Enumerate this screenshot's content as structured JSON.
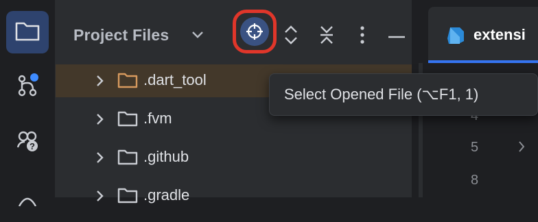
{
  "tool_stripe": {
    "buttons": [
      {
        "icon": "folder-icon",
        "active": true
      },
      {
        "icon": "git-branch-icon",
        "active": false,
        "badge": true
      },
      {
        "icon": "help-community-icon",
        "active": false
      },
      {
        "icon": "partial-icon",
        "active": false
      }
    ]
  },
  "project_panel": {
    "title": "Project Files",
    "toolbar_icons": [
      "locate-file-icon",
      "expand-all-icon",
      "collapse-all-icon",
      "more-options-icon",
      "hide-panel-icon"
    ],
    "tree": [
      {
        "label": ".dart_tool",
        "selected": true,
        "folder_color": "#d79a5e"
      },
      {
        "label": ".fvm",
        "selected": false,
        "folder_color": "#c9ccd2"
      },
      {
        "label": ".github",
        "selected": false,
        "folder_color": "#c9ccd2"
      },
      {
        "label": ".gradle",
        "selected": false,
        "folder_color": "#c9ccd2"
      }
    ]
  },
  "editor": {
    "tab_label": "extensi",
    "line_numbers": [
      "4",
      "5",
      "8"
    ]
  },
  "tooltip": {
    "text": "Select Opened File (⌥F1, 1)"
  },
  "colors": {
    "accent": "#3574f0",
    "highlight_border": "#e0362a",
    "badge": "#3e8bff"
  }
}
